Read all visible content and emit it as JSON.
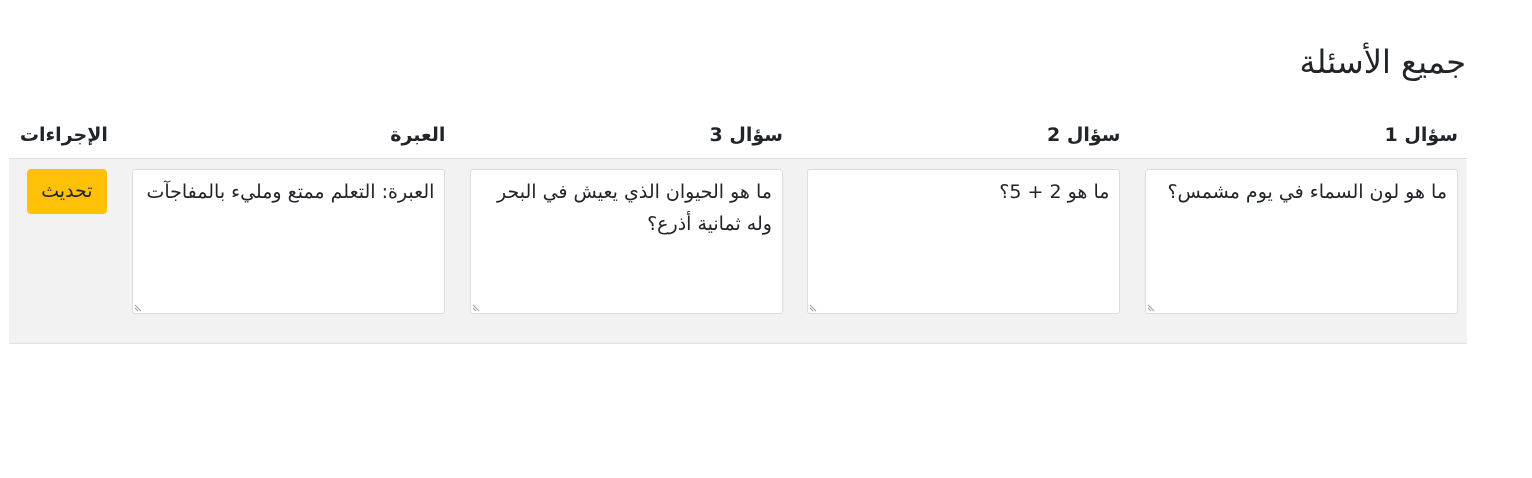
{
  "page": {
    "title": "جميع الأسئلة"
  },
  "table": {
    "headers": {
      "q1": "سؤال 1",
      "q2": "سؤال 2",
      "q3": "سؤال 3",
      "lesson": "العبرة",
      "actions": "الإجراءات"
    },
    "rows": [
      {
        "q1": "ما هو لون السماء في يوم مشمس؟",
        "q2": "ما هو 2 + 5؟",
        "q3": "ما هو الحيوان الذي يعيش في البحر وله ثمانية أذرع؟",
        "lesson": "العبرة: التعلم ممتع ومليء بالمفاجآت",
        "update_label": "تحديث"
      }
    ]
  },
  "colors": {
    "update_button": "#ffc107",
    "row_background": "#f2f2f2"
  }
}
